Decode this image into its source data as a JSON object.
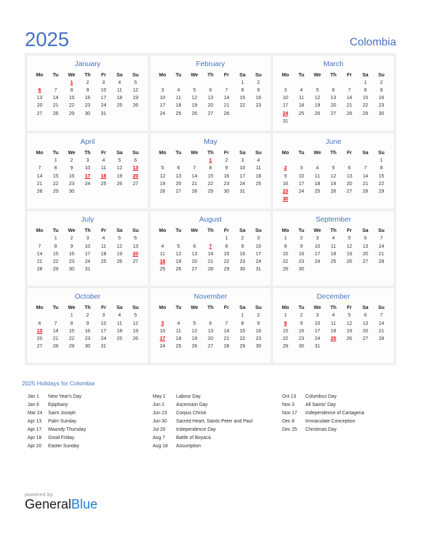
{
  "header": {
    "year": "2025",
    "country": "Colombia",
    "accent_color": "#4472C4",
    "holiday_color": "#e8050f"
  },
  "weekday_headers": [
    "Mo",
    "Tu",
    "We",
    "Th",
    "Fr",
    "Sa",
    "Su"
  ],
  "months": [
    {
      "name": "January",
      "lead_blanks": 2,
      "days": 31,
      "holidays": [
        1,
        6
      ]
    },
    {
      "name": "February",
      "lead_blanks": 5,
      "days": 28,
      "holidays": []
    },
    {
      "name": "March",
      "lead_blanks": 5,
      "days": 31,
      "holidays": [
        24
      ]
    },
    {
      "name": "April",
      "lead_blanks": 1,
      "days": 30,
      "holidays": [
        13,
        17,
        18,
        20
      ]
    },
    {
      "name": "May",
      "lead_blanks": 3,
      "days": 31,
      "holidays": [
        1
      ]
    },
    {
      "name": "June",
      "lead_blanks": 6,
      "days": 30,
      "holidays": [
        2,
        23,
        30
      ]
    },
    {
      "name": "July",
      "lead_blanks": 1,
      "days": 31,
      "holidays": [
        20
      ]
    },
    {
      "name": "August",
      "lead_blanks": 4,
      "days": 31,
      "holidays": [
        7,
        18
      ]
    },
    {
      "name": "September",
      "lead_blanks": 0,
      "days": 30,
      "holidays": []
    },
    {
      "name": "October",
      "lead_blanks": 2,
      "days": 31,
      "holidays": [
        13
      ]
    },
    {
      "name": "November",
      "lead_blanks": 5,
      "days": 30,
      "holidays": [
        3,
        17
      ]
    },
    {
      "name": "December",
      "lead_blanks": 0,
      "days": 31,
      "holidays": [
        8,
        25
      ]
    }
  ],
  "holidays_section": {
    "title": "2025 Holidays for Colombia",
    "columns": [
      [
        {
          "date": "Jan 1",
          "name": "New Year's Day"
        },
        {
          "date": "Jan 6",
          "name": "Epiphany"
        },
        {
          "date": "Mar 24",
          "name": "Saint Joseph"
        },
        {
          "date": "Apr 13",
          "name": "Palm Sunday"
        },
        {
          "date": "Apr 17",
          "name": "Maundy Thursday"
        },
        {
          "date": "Apr 18",
          "name": "Good Friday"
        },
        {
          "date": "Apr 20",
          "name": "Easter Sunday"
        }
      ],
      [
        {
          "date": "May 1",
          "name": "Labour Day"
        },
        {
          "date": "Jun 2",
          "name": "Ascension Day"
        },
        {
          "date": "Jun 23",
          "name": "Corpus Christi"
        },
        {
          "date": "Jun 30",
          "name": "Sacred Heart, Saints Peter and Paul"
        },
        {
          "date": "Jul 20",
          "name": "Independence Day"
        },
        {
          "date": "Aug 7",
          "name": "Battle of Boyacá"
        },
        {
          "date": "Aug 18",
          "name": "Assumption"
        }
      ],
      [
        {
          "date": "Oct 13",
          "name": "Columbus Day"
        },
        {
          "date": "Nov 3",
          "name": "All Saints' Day"
        },
        {
          "date": "Nov 17",
          "name": "Independence of Cartagena"
        },
        {
          "date": "Dec 8",
          "name": "Immaculate Conception"
        },
        {
          "date": "Dec 25",
          "name": "Christmas Day"
        }
      ]
    ]
  },
  "footer": {
    "powered_by": "powered by",
    "logo_part1": "General",
    "logo_part2": "Blue"
  }
}
